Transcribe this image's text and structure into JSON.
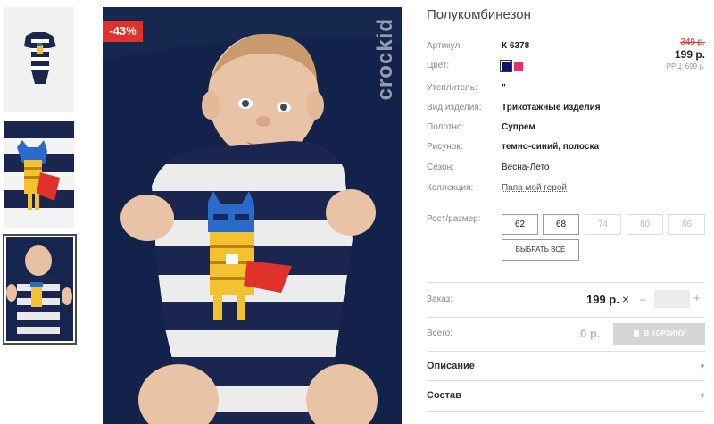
{
  "product": {
    "title": "Полукомбинезон",
    "discount_badge": "-43%",
    "brand": "crockid"
  },
  "attributes": [
    {
      "label": "Артикул:",
      "value": "К 6378"
    },
    {
      "label": "Цвет:",
      "value": ""
    },
    {
      "label": "Утеплитель:",
      "value": "\""
    },
    {
      "label": "Вид изделия:",
      "value": "Трикотажные изделия"
    },
    {
      "label": "Полотно:",
      "value": "Супрем"
    },
    {
      "label": "Рисунок:",
      "value": "темно-синий, полоска"
    },
    {
      "label": "Сезон:",
      "value": "Весна-Лето"
    },
    {
      "label": "Коллекция:",
      "value": "Папа мой герой"
    }
  ],
  "colors": [
    "#10136b",
    "#e8306e"
  ],
  "price": {
    "old": "349 р.",
    "new": "199 р.",
    "rrp": "РРЦ: 699 р."
  },
  "sizes": {
    "label": "Рост/размер:",
    "options": [
      {
        "value": "62",
        "available": true
      },
      {
        "value": "68",
        "available": true
      },
      {
        "value": "74",
        "available": false
      },
      {
        "value": "80",
        "available": false
      },
      {
        "value": "86",
        "available": false
      }
    ],
    "select_all": "ВЫБРАТЬ ВСЕ"
  },
  "order": {
    "label": "Заказ:",
    "price": "199 р.",
    "times": "×",
    "minus": "–",
    "plus": "+",
    "qty": ""
  },
  "total": {
    "label": "Всего:",
    "value": "0 р.",
    "cart_button": "В КОРЗИНУ"
  },
  "accordion": [
    {
      "label": "Описание"
    },
    {
      "label": "Состав"
    }
  ]
}
